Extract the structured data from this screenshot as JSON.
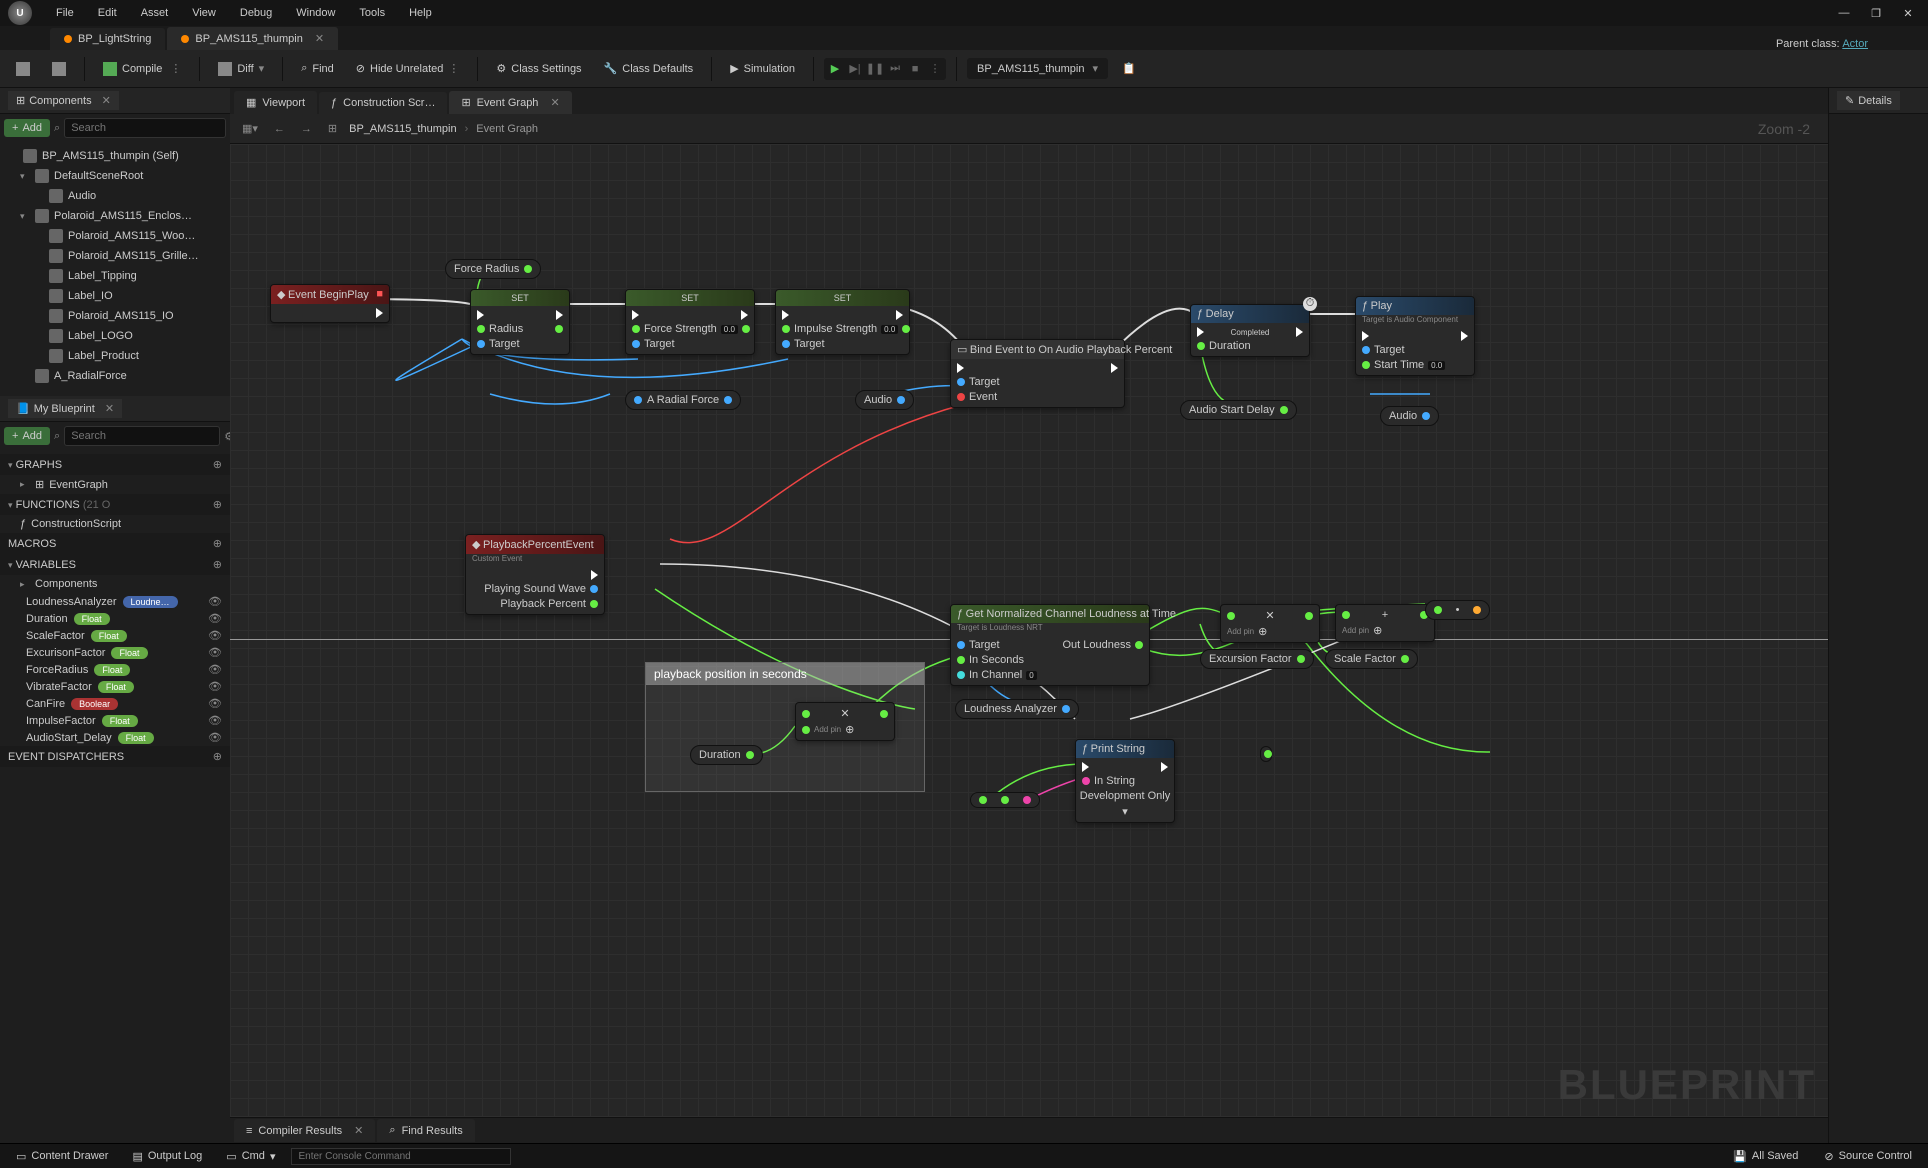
{
  "menubar": [
    "File",
    "Edit",
    "Asset",
    "View",
    "Debug",
    "Window",
    "Tools",
    "Help"
  ],
  "parent_class": {
    "label": "Parent class:",
    "link": "Actor"
  },
  "file_tabs": [
    {
      "label": "BP_LightString",
      "active": false,
      "dot": "orange"
    },
    {
      "label": "BP_AMS115_thumpin",
      "active": true,
      "dot": "orange",
      "closable": true
    }
  ],
  "toolbar": {
    "compile": "Compile",
    "diff": "Diff",
    "find": "Find",
    "hide": "Hide Unrelated",
    "class_settings": "Class Settings",
    "class_defaults": "Class Defaults",
    "simulation": "Simulation",
    "dropdown": "BP_AMS115_thumpin"
  },
  "components_panel": {
    "title": "Components",
    "add": "Add",
    "search_ph": "Search",
    "tree": [
      {
        "label": "BP_AMS115_thumpin (Self)",
        "indent": 0,
        "icon": "actor"
      },
      {
        "label": "DefaultSceneRoot",
        "indent": 1,
        "icon": "scene",
        "expand": true
      },
      {
        "label": "Audio",
        "indent": 2,
        "icon": "audio"
      },
      {
        "label": "Polaroid_AMS115_Enclos…",
        "indent": 1,
        "icon": "mesh",
        "expand": true
      },
      {
        "label": "Polaroid_AMS115_Woo…",
        "indent": 2,
        "icon": "mesh"
      },
      {
        "label": "Polaroid_AMS115_Grille…",
        "indent": 2,
        "icon": "mesh"
      },
      {
        "label": "Label_Tipping",
        "indent": 2,
        "icon": "mesh"
      },
      {
        "label": "Label_IO",
        "indent": 2,
        "icon": "mesh"
      },
      {
        "label": "Polaroid_AMS115_IO",
        "indent": 2,
        "icon": "mesh"
      },
      {
        "label": "Label_LOGO",
        "indent": 2,
        "icon": "mesh"
      },
      {
        "label": "Label_Product",
        "indent": 2,
        "icon": "mesh"
      },
      {
        "label": "A_RadialForce",
        "indent": 1,
        "icon": "force"
      }
    ]
  },
  "myblueprint": {
    "title": "My Blueprint",
    "add": "Add",
    "search_ph": "Search",
    "sections": {
      "graphs": "GRAPHS",
      "eventgraph": "EventGraph",
      "functions": "FUNCTIONS",
      "func_count": "(21 O",
      "construct": "ConstructionScript",
      "macros": "MACROS",
      "variables": "VARIABLES",
      "components_sub": "Components",
      "dispatchers": "EVENT DISPATCHERS"
    },
    "vars": [
      {
        "name": "LoudnessAnalyzer",
        "type": "Loudne…",
        "pill": "obj"
      },
      {
        "name": "Duration",
        "type": "Float",
        "pill": "float"
      },
      {
        "name": "ScaleFactor",
        "type": "Float",
        "pill": "float"
      },
      {
        "name": "ExcurisonFactor",
        "type": "Float",
        "pill": "float"
      },
      {
        "name": "ForceRadius",
        "type": "Float",
        "pill": "float"
      },
      {
        "name": "VibrateFactor",
        "type": "Float",
        "pill": "float"
      },
      {
        "name": "CanFire",
        "type": "Boolear",
        "pill": "bool"
      },
      {
        "name": "ImpulseFactor",
        "type": "Float",
        "pill": "float"
      },
      {
        "name": "AudioStart_Delay",
        "type": "Float",
        "pill": "float"
      }
    ]
  },
  "center": {
    "tabs": [
      {
        "label": "Viewport",
        "icon": "viewport"
      },
      {
        "label": "Construction Scr…",
        "icon": "func"
      },
      {
        "label": "Event Graph",
        "icon": "graph",
        "active": true,
        "closable": true
      }
    ],
    "breadcrumb": {
      "asset": "BP_AMS115_thumpin",
      "graph": "Event Graph"
    },
    "zoom": "Zoom -2",
    "watermark": "BLUEPRINT"
  },
  "nodes": {
    "beginplay": "Event BeginPlay",
    "forceradius": "Force Radius",
    "set": "SET",
    "radius": "Radius",
    "target": "Target",
    "force_strength": "Force Strength",
    "impulse_strength": "Impulse Strength",
    "aradial": "A Radial Force",
    "audio": "Audio",
    "bind": "Bind Event to On Audio Playback Percent",
    "event_pin": "Event",
    "delay": "Delay",
    "duration": "Duration",
    "completed": "Completed",
    "audio_start": "Audio Start Delay",
    "play": "Play",
    "play_sub": "Target is Audio Component",
    "start_time": "Start Time",
    "playback_event": "PlaybackPercentEvent",
    "custom_event": "Custom Event",
    "playing_sw": "Playing Sound Wave",
    "playback_pct": "Playback Percent",
    "comment": "playback position in seconds",
    "addpin": "Add pin",
    "duration_var": "Duration",
    "loudness": "Get Normalized Channel Loudness at Time",
    "loudness_sub": "Target is Loudness NRT",
    "in_seconds": "In Seconds",
    "in_channel": "In Channel",
    "out_loudness": "Out Loudness",
    "loudness_analyzer": "Loudness Analyzer",
    "excursion": "Excursion Factor",
    "scale": "Scale Factor",
    "printstr": "Print String",
    "instring": "In String",
    "devonly": "Development Only",
    "val00": "0.0",
    "val0": "0"
  },
  "details": {
    "title": "Details"
  },
  "bottom": {
    "compiler": "Compiler Results",
    "find": "Find Results"
  },
  "status": {
    "drawer": "Content Drawer",
    "output": "Output Log",
    "cmd": "Cmd",
    "cmd_ph": "Enter Console Command",
    "saved": "All Saved",
    "source": "Source Control"
  }
}
